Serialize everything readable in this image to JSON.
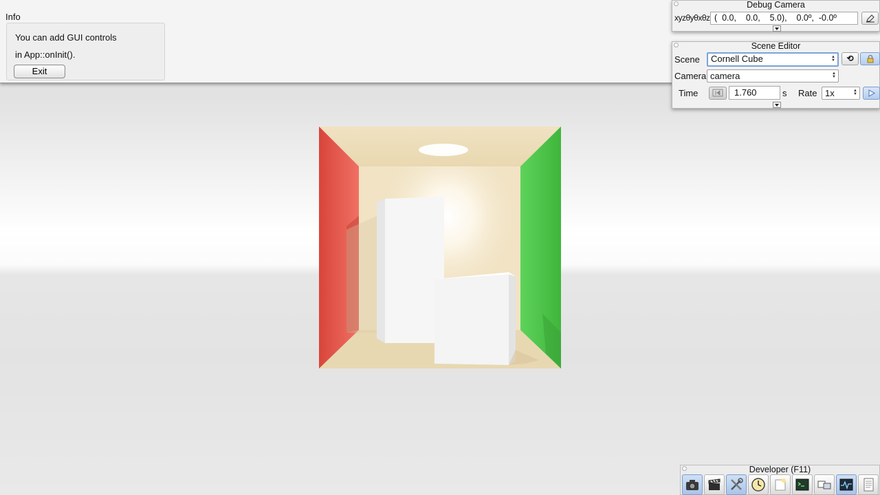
{
  "info": {
    "title": "Info",
    "line1": "You can add GUI controls",
    "line2": "in App::onInit().",
    "exit_label": "Exit"
  },
  "debug_camera": {
    "title": "Debug Camera",
    "coord_label": "xyzθyθxθz",
    "coord_value": "(  0.0,    0.0,    5.0),    0.0º,  -0.0º"
  },
  "scene_editor": {
    "title": "Scene Editor",
    "scene_label": "Scene",
    "scene_value": "Cornell Cube",
    "camera_label": "Camera",
    "camera_value": "camera",
    "time_label": "Time",
    "time_value": "1.760",
    "time_unit": "s",
    "rate_label": "Rate",
    "rate_value": "1x"
  },
  "developer": {
    "title": "Developer (F11)",
    "buttons": [
      {
        "icon": "camera-icon"
      },
      {
        "icon": "clapperboard-icon"
      },
      {
        "icon": "tools-icon"
      },
      {
        "icon": "clock-icon"
      },
      {
        "icon": "scene-icon"
      },
      {
        "icon": "terminal-icon"
      },
      {
        "icon": "windows-icon"
      },
      {
        "icon": "graph-icon"
      },
      {
        "icon": "document-icon"
      }
    ]
  },
  "colors": {
    "left_wall": "#e2574a",
    "right_wall": "#4fcc4a",
    "back_wall": "#f0e2c2",
    "floor": "#e7d7b4",
    "accent": "#7aa3da"
  }
}
